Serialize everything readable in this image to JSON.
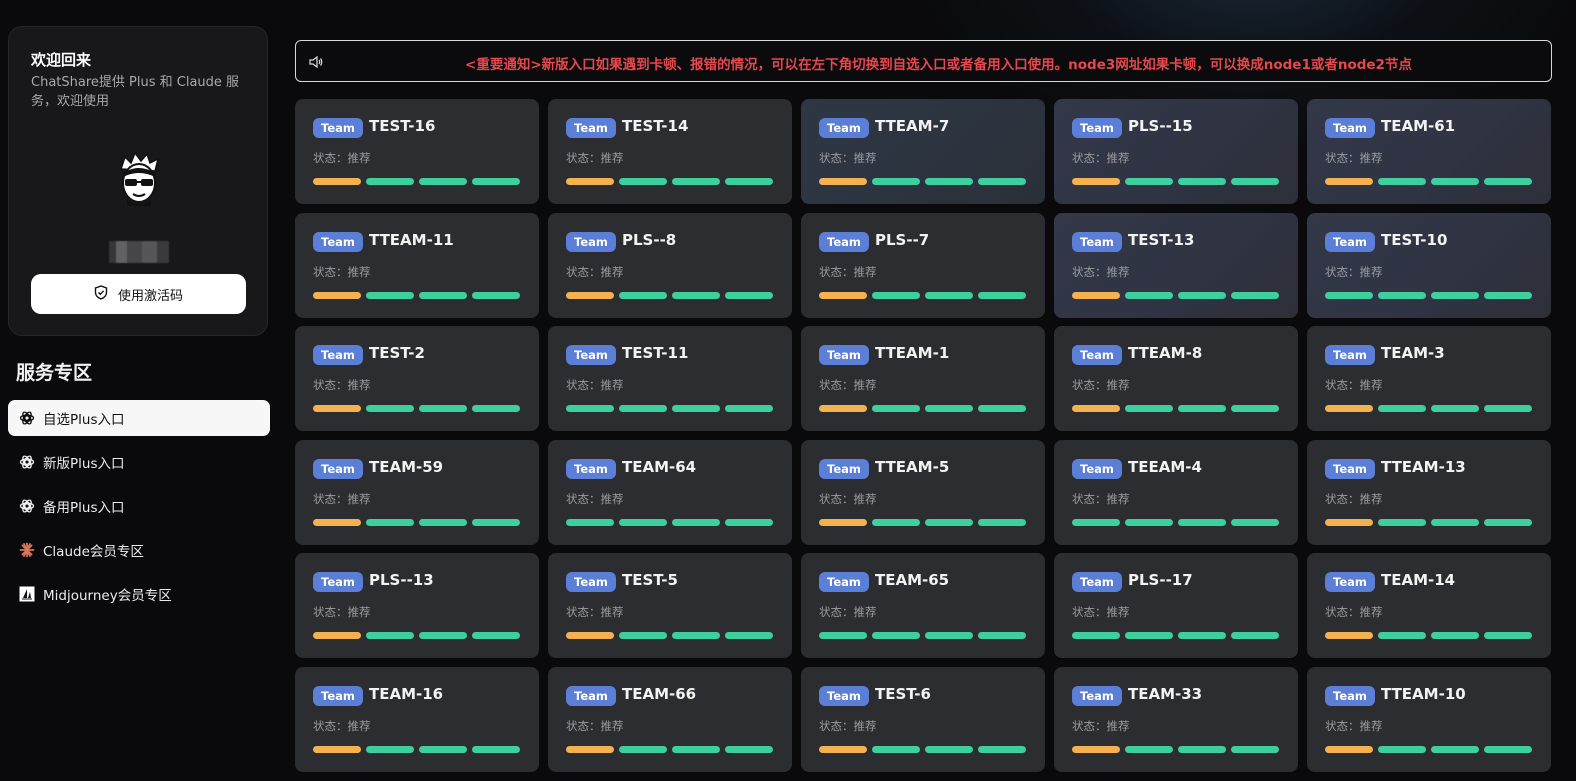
{
  "sidebar": {
    "welcome_title": "欢迎回来",
    "welcome_desc": "ChatShare提供 Plus 和 Claude 服务，欢迎使用",
    "activate_label": "使用激活码",
    "section_title": "服务专区",
    "nav_items": [
      {
        "label": "自选Plus入口",
        "icon": "openai-icon",
        "active": true
      },
      {
        "label": "新版Plus入口",
        "icon": "openai-icon",
        "active": false
      },
      {
        "label": "备用Plus入口",
        "icon": "openai-icon",
        "active": false
      },
      {
        "label": "Claude会员专区",
        "icon": "claude-icon",
        "active": false
      },
      {
        "label": "Midjourney会员专区",
        "icon": "midjourney-icon",
        "active": false
      }
    ]
  },
  "notice": {
    "icon": "speaker-icon",
    "text": "<重要通知>新版入口如果遇到卡顿、报错的情况，可以在左下角切换到自选入口或者备用入口使用。node3网址如果卡顿，可以换成node1或者node2节点"
  },
  "colors": {
    "tag": "#5b7ed6",
    "bar_green": "#3ecf9e",
    "bar_orange": "#f4b150",
    "notice_text": "#e5484d"
  },
  "cards": [
    {
      "tag": "Team",
      "name": "TEST-16",
      "status": "状态：推荐",
      "first_bar": "orange"
    },
    {
      "tag": "Team",
      "name": "TEST-14",
      "status": "状态：推荐",
      "first_bar": "orange"
    },
    {
      "tag": "Team",
      "name": "TTEAM-7",
      "status": "状态：推荐",
      "first_bar": "orange"
    },
    {
      "tag": "Team",
      "name": "PLS--15",
      "status": "状态：推荐",
      "first_bar": "orange"
    },
    {
      "tag": "Team",
      "name": "TEAM-61",
      "status": "状态：推荐",
      "first_bar": "orange"
    },
    {
      "tag": "Team",
      "name": "TTEAM-11",
      "status": "状态：推荐",
      "first_bar": "orange"
    },
    {
      "tag": "Team",
      "name": "PLS--8",
      "status": "状态：推荐",
      "first_bar": "orange"
    },
    {
      "tag": "Team",
      "name": "PLS--7",
      "status": "状态：推荐",
      "first_bar": "orange"
    },
    {
      "tag": "Team",
      "name": "TEST-13",
      "status": "状态：推荐",
      "first_bar": "orange"
    },
    {
      "tag": "Team",
      "name": "TEST-10",
      "status": "状态：推荐",
      "first_bar": "green"
    },
    {
      "tag": "Team",
      "name": "TEST-2",
      "status": "状态：推荐",
      "first_bar": "orange"
    },
    {
      "tag": "Team",
      "name": "TEST-11",
      "status": "状态：推荐",
      "first_bar": "green"
    },
    {
      "tag": "Team",
      "name": "TTEAM-1",
      "status": "状态：推荐",
      "first_bar": "orange"
    },
    {
      "tag": "Team",
      "name": "TTEAM-8",
      "status": "状态：推荐",
      "first_bar": "orange"
    },
    {
      "tag": "Team",
      "name": "TEAM-3",
      "status": "状态：推荐",
      "first_bar": "orange"
    },
    {
      "tag": "Team",
      "name": "TEAM-59",
      "status": "状态：推荐",
      "first_bar": "orange"
    },
    {
      "tag": "Team",
      "name": "TEAM-64",
      "status": "状态：推荐",
      "first_bar": "green"
    },
    {
      "tag": "Team",
      "name": "TTEAM-5",
      "status": "状态：推荐",
      "first_bar": "orange"
    },
    {
      "tag": "Team",
      "name": "TEEAM-4",
      "status": "状态：推荐",
      "first_bar": "green"
    },
    {
      "tag": "Team",
      "name": "TTEAM-13",
      "status": "状态：推荐",
      "first_bar": "orange"
    },
    {
      "tag": "Team",
      "name": "PLS--13",
      "status": "状态：推荐",
      "first_bar": "orange"
    },
    {
      "tag": "Team",
      "name": "TEST-5",
      "status": "状态：推荐",
      "first_bar": "orange"
    },
    {
      "tag": "Team",
      "name": "TEAM-65",
      "status": "状态：推荐",
      "first_bar": "green"
    },
    {
      "tag": "Team",
      "name": "PLS--17",
      "status": "状态：推荐",
      "first_bar": "green"
    },
    {
      "tag": "Team",
      "name": "TEAM-14",
      "status": "状态：推荐",
      "first_bar": "orange"
    },
    {
      "tag": "Team",
      "name": "TEAM-16",
      "status": "状态：推荐",
      "first_bar": "orange"
    },
    {
      "tag": "Team",
      "name": "TEAM-66",
      "status": "状态：推荐",
      "first_bar": "orange"
    },
    {
      "tag": "Team",
      "name": "TEST-6",
      "status": "状态：推荐",
      "first_bar": "orange"
    },
    {
      "tag": "Team",
      "name": "TEAM-33",
      "status": "状态：推荐",
      "first_bar": "orange"
    },
    {
      "tag": "Team",
      "name": "TTEAM-10",
      "status": "状态：推荐",
      "first_bar": "orange"
    }
  ]
}
